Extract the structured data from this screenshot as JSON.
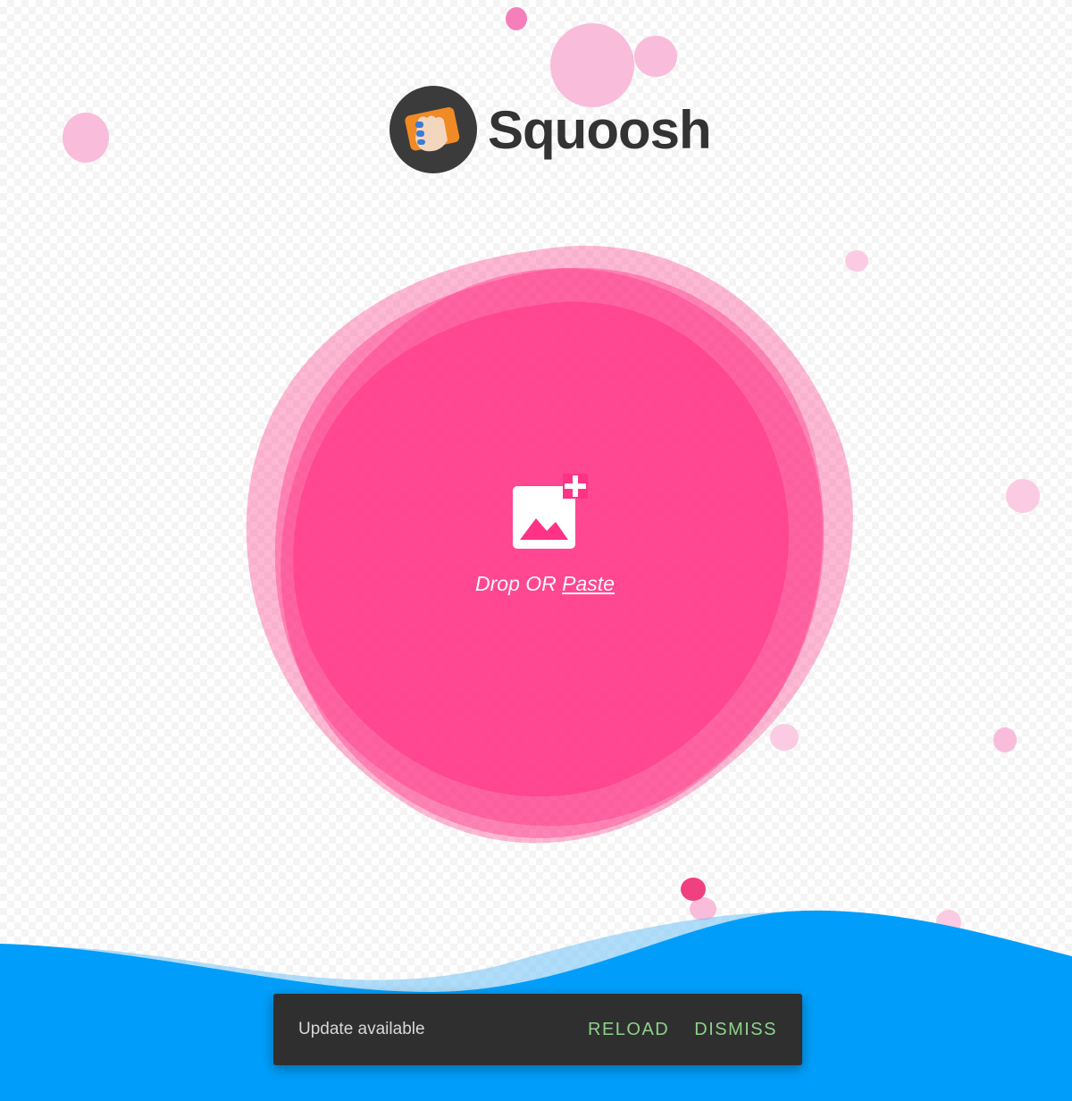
{
  "app": {
    "brand_name": "Squoosh"
  },
  "dropzone": {
    "prefix_text": "Drop OR ",
    "paste_label": "Paste",
    "icon": "add-image-icon"
  },
  "snackbar": {
    "message": "Update available",
    "reload_label": "RELOAD",
    "dismiss_label": "DISMISS"
  },
  "colors": {
    "blob": "#ff3385",
    "wave": "#009efa",
    "snackbar_background": "#2f2f2f",
    "snackbar_action": "#8fd18a"
  }
}
